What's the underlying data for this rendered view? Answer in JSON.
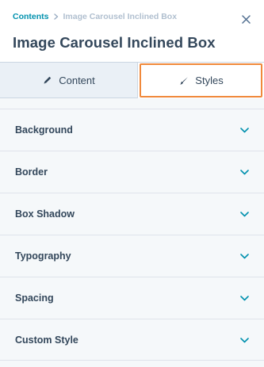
{
  "breadcrumb": {
    "parent": "Contents",
    "current": "Image Carousel Inclined Box"
  },
  "header": {
    "title": "Image Carousel Inclined Box",
    "close_icon": "close-icon"
  },
  "tabs": [
    {
      "label": "Content",
      "icon": "pencil-icon",
      "active": false
    },
    {
      "label": "Styles",
      "icon": "brush-icon",
      "active": true
    }
  ],
  "sections": [
    {
      "label": "Background"
    },
    {
      "label": "Border"
    },
    {
      "label": "Box Shadow"
    },
    {
      "label": "Typography"
    },
    {
      "label": "Spacing"
    },
    {
      "label": "Custom Style"
    }
  ],
  "colors": {
    "link": "#0091ae",
    "text": "#33475b",
    "focus_outline": "#f0893b",
    "chevron": "#0091ae",
    "panel_bg": "#f5f8fa"
  }
}
